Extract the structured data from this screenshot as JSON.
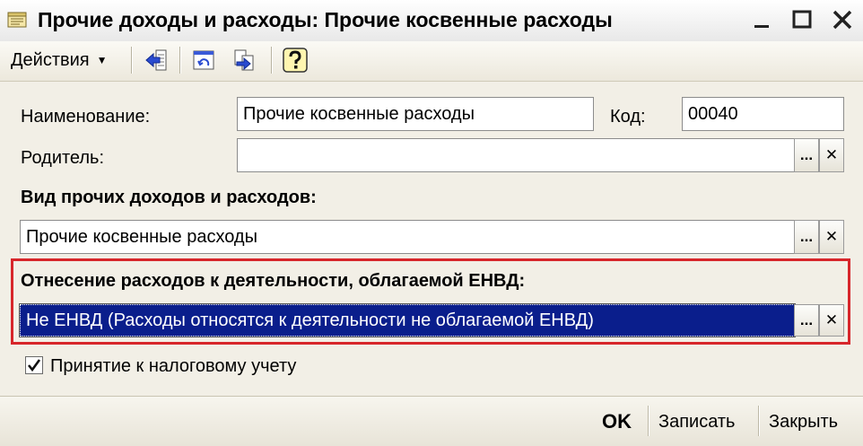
{
  "window": {
    "title": "Прочие доходы и расходы: Прочие косвенные расходы",
    "icons": [
      "document-icon",
      "minimize-icon",
      "maximize-icon",
      "close-icon"
    ]
  },
  "toolbar": {
    "actions_label": "Действия",
    "buttons": [
      "back-to-list-icon",
      "structure-icon",
      "move-icon",
      "help-icon"
    ]
  },
  "form": {
    "name_label": "Наименование:",
    "name_value": "Прочие косвенные расходы",
    "code_label": "Код:",
    "code_value": "00040",
    "parent_label": "Родитель:",
    "parent_value": "",
    "kind_label": "Вид прочих доходов и расходов:",
    "kind_value": "Прочие косвенные расходы",
    "envd_label": "Отнесение расходов к деятельности, облагаемой ЕНВД:",
    "envd_value": "Не ЕНВД (Расходы относятся к деятельности  не облагаемой ЕНВД)",
    "tax_label": "Принятие к налоговому учету",
    "tax_checked": true,
    "select_symbol": "...",
    "clear_symbol": "✕"
  },
  "footer": {
    "ok_label": "OK",
    "save_label": "Записать",
    "close_label": "Закрыть"
  },
  "colors": {
    "highlight_border": "#d7262b",
    "selection_background": "#0a1e8c"
  }
}
